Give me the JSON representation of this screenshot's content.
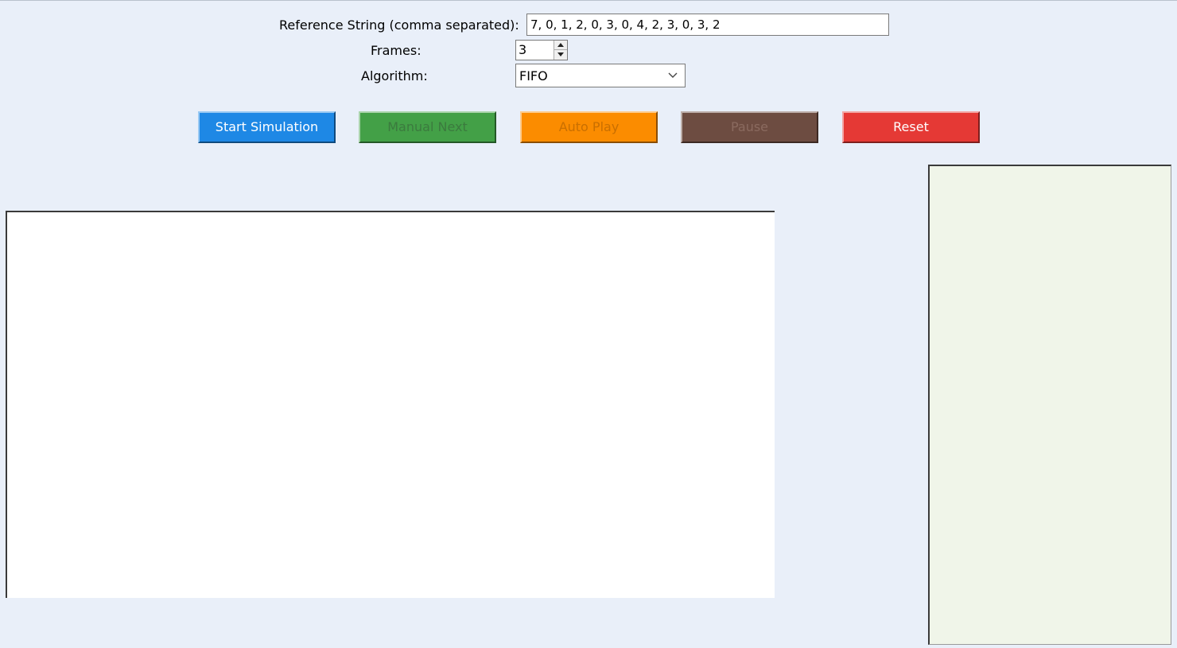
{
  "form": {
    "reference_label": "Reference String (comma separated):",
    "reference_value": "7, 0, 1, 2, 0, 3, 0, 4, 2, 3, 0, 3, 2",
    "frames_label": "Frames:",
    "frames_value": "3",
    "algorithm_label": "Algorithm:",
    "algorithm_value": "FIFO"
  },
  "buttons": {
    "start": {
      "label": "Start Simulation",
      "bg": "#1e88e5",
      "fg": "#ffffff"
    },
    "next": {
      "label": "Manual Next",
      "bg": "#43a047",
      "fg": "#3b7a3e"
    },
    "auto": {
      "label": "Auto Play",
      "bg": "#fb8c00",
      "fg": "#c96f00"
    },
    "pause": {
      "label": "Pause",
      "bg": "#6d4c41",
      "fg": "#8a6a5f"
    },
    "reset": {
      "label": "Reset",
      "bg": "#e53935",
      "fg": "#ffffff"
    }
  },
  "icons": {
    "spin_up": "triangle-up-icon",
    "spin_down": "triangle-down-icon",
    "dropdown": "chevron-down-icon"
  },
  "colors": {
    "window_bg": "#e9eff9",
    "main_panel_bg": "#ffffff",
    "side_panel_bg": "#f0f5e9"
  }
}
